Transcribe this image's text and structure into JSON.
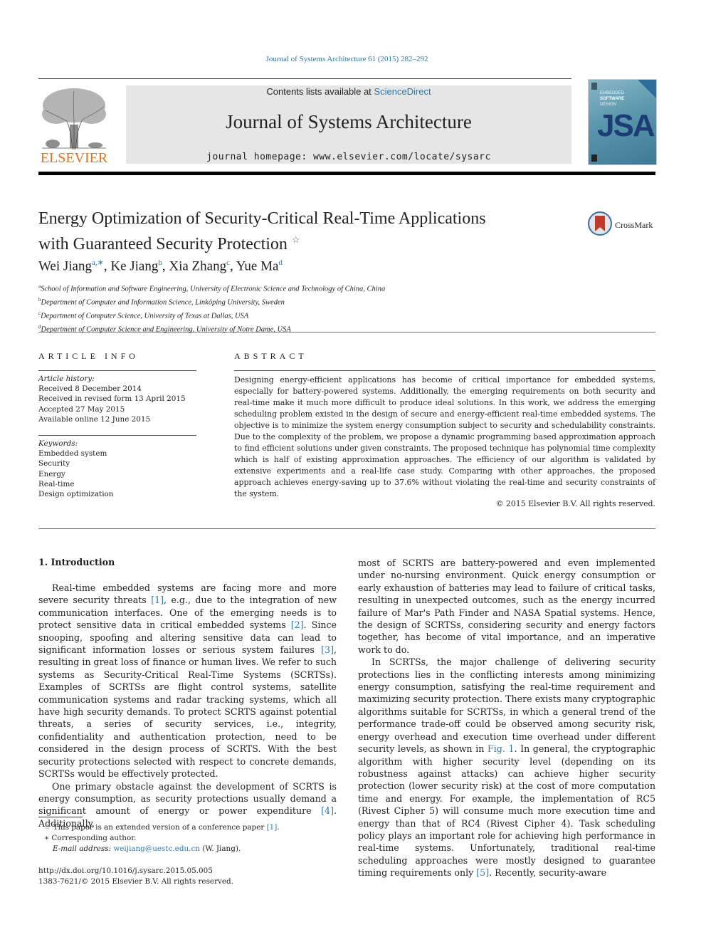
{
  "header": {
    "journal_reference": "Journal of Systems Architecture 61 (2015) 282–292",
    "contents_prefix": "Contents lists available at ",
    "contents_link": "ScienceDirect",
    "journal_title": "Journal of Systems Architecture",
    "homepage": "journal homepage: www.elsevier.com/locate/sysarc",
    "publisher_logo_text": "ELSEVIER",
    "cover": {
      "line1": "EMBEDDED",
      "line2": "SOFTWARE",
      "line3": "DESIGN",
      "acronym": "JSA"
    },
    "colors": {
      "link": "#2a7ab0",
      "publisher_orange": "#e9711c",
      "banner_bg": "#e6e6e6"
    }
  },
  "article": {
    "title_line1": "Energy Optimization of Security-Critical Real-Time Applications",
    "title_line2": "with Guaranteed Security Protection",
    "title_note_mark": "☆",
    "crossmark_label": "CrossMark",
    "authors": [
      {
        "name": "Wei Jiang",
        "sup": "a,∗"
      },
      {
        "name": "Ke Jiang",
        "sup": "b"
      },
      {
        "name": "Xia Zhang",
        "sup": "c"
      },
      {
        "name": "Yue Ma",
        "sup": "d"
      }
    ],
    "affiliations": [
      {
        "mark": "a",
        "text": "School of Information and Software Engineering, University of Electronic Science and Technology of China, China"
      },
      {
        "mark": "b",
        "text": "Department of Computer and Information Science, Linköping University, Sweden"
      },
      {
        "mark": "c",
        "text": "Department of Computer Science, University of Texas at Dallas, USA"
      },
      {
        "mark": "d",
        "text": "Department of Computer Science and Engineering, University of Notre Dame, USA"
      }
    ]
  },
  "article_info": {
    "heading": "ARTICLE INFO",
    "history_label": "Article history:",
    "history": [
      "Received 8 December 2014",
      "Received in revised form 13 April 2015",
      "Accepted 27 May 2015",
      "Available online 12 June 2015"
    ],
    "keywords_label": "Keywords:",
    "keywords": [
      "Embedded system",
      "Security",
      "Energy",
      "Real-time",
      "Design optimization"
    ]
  },
  "abstract": {
    "heading": "ABSTRACT",
    "text": "Designing energy-efficient applications has become of critical importance for embedded systems, especially for battery-powered systems. Additionally, the emerging requirements on both security and real-time make it much more difficult to produce ideal solutions. In this work, we address the emerging scheduling problem existed in the design of secure and energy-efficient real-time embedded systems. The objective is to minimize the system energy consumption subject to security and schedulability constraints. Due to the complexity of the problem, we propose a dynamic programming based approximation approach to find efficient solutions under given constraints. The proposed technique has polynomial time complexity which is half of existing approximation approaches. The efficiency of our algorithm is validated by extensive experiments and a real-life case study. Comparing with other approaches, the proposed approach achieves energy-saving up to 37.6% without violating the real-time and security constraints of the system.",
    "copyright": "© 2015 Elsevier B.V. All rights reserved."
  },
  "introduction": {
    "heading": "1. Introduction",
    "left_col": {
      "p1": [
        {
          "t": "Real-time embedded systems are facing more and more severe security threats "
        },
        {
          "ref": "[1]"
        },
        {
          "t": ", e.g., due to the integration of new communication interfaces. One of the emerging needs is to protect sensitive data in critical embedded systems "
        },
        {
          "ref": "[2]"
        },
        {
          "t": ". Since snooping, spoofing and altering sensitive data can lead to significant information losses or serious system failures "
        },
        {
          "ref": "[3]"
        },
        {
          "t": ", resulting in great loss of finance or human lives. We refer to such systems as Security-Critical Real-Time Systems (SCRTSs). Examples of SCRTSs are flight control systems, satellite communication systems and radar tracking systems, which all have high security demands. To protect SCRTS against potential threats, a series of security services, i.e., integrity, confidentiality and authentication protection, need to be considered in the design process of SCRTS. With the best security protections selected with respect to concrete demands, SCRTSs would be effectively protected."
        }
      ],
      "p2": [
        {
          "t": "One primary obstacle against the development of SCRTS is energy consumption, as security protections usually demand a significant amount of energy or power expenditure "
        },
        {
          "ref": "[4]"
        },
        {
          "t": ". Additionally,"
        }
      ]
    },
    "right_col": {
      "p1": [
        {
          "t": "most of SCRTS are battery-powered and even implemented under no-nursing environment. Quick energy consumption or early exhaustion of batteries may lead to failure of critical tasks, resulting in unexpected outcomes, such as the energy incurred failure of Mar's Path Finder and NASA Spatial systems. Hence, the design of SCRTSs, considering security and energy factors together, has become of vital importance, and an imperative work to do."
        }
      ],
      "p2": [
        {
          "t": "In SCRTSs, the major challenge of delivering security protections lies in the conflicting interests among minimizing energy consumption, satisfying the real-time requirement and maximizing security protection. There exists many cryptographic algorithms suitable for SCRTSs, in which a general trend of the performance trade-off could be observed among security risk, energy overhead and execution time overhead under different security levels, as shown in "
        },
        {
          "ref": "Fig. 1"
        },
        {
          "t": ". In general, the cryptographic algorithm with higher security level (depending on its robustness against attacks) can achieve higher security protection (lower security risk) at the cost of more computation time and energy. For example, the implementation of RC5 (Rivest Cipher 5) will consume much more execution time and energy than that of RC4 (Rivest Cipher 4). Task scheduling policy plays an important role for achieving high performance in real-time systems. Unfortunately, traditional real-time scheduling approaches were mostly designed to guarantee timing requirements only "
        },
        {
          "ref": "[5]"
        },
        {
          "t": ". Recently, security-aware"
        }
      ]
    }
  },
  "footnotes": {
    "star_mark": "☆",
    "star_text": "This paper is an extended version of a conference paper ",
    "star_ref": "[1]",
    "corr_mark": "∗",
    "corr_text": "Corresponding author.",
    "email_label": "E-mail address: ",
    "email": "weijiang@uestc.edu.cn",
    "email_suffix": " (W. Jiang).",
    "doi": "http://dx.doi.org/10.1016/j.sysarc.2015.05.005",
    "issn_copyright": "1383-7621/© 2015 Elsevier B.V. All rights reserved."
  }
}
